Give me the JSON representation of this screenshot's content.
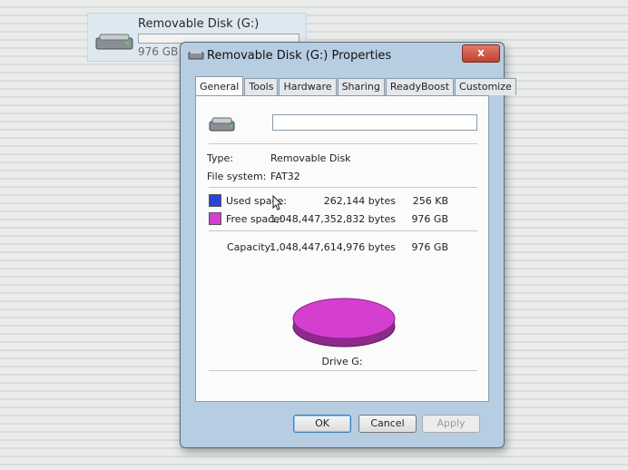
{
  "background_item": {
    "title": "Removable Disk (G:)",
    "subtitle": "976 GB f"
  },
  "dialog": {
    "title": "Removable Disk (G:) Properties",
    "close_label": "x",
    "tabs": [
      {
        "label": "General",
        "active": true
      },
      {
        "label": "Tools",
        "active": false
      },
      {
        "label": "Hardware",
        "active": false
      },
      {
        "label": "Sharing",
        "active": false
      },
      {
        "label": "ReadyBoost",
        "active": false
      },
      {
        "label": "Customize",
        "active": false
      }
    ],
    "name_field": {
      "value": ""
    },
    "type": {
      "label": "Type:",
      "value": "Removable Disk"
    },
    "file_system": {
      "label": "File system:",
      "value": "FAT32"
    },
    "used": {
      "label": "Used space:",
      "bytes": "262,144 bytes",
      "size": "256 KB",
      "color": "#2a46d8"
    },
    "free": {
      "label": "Free space:",
      "bytes": "1,048,447,352,832 bytes",
      "size": "976 GB",
      "color": "#d43fd0"
    },
    "capacity": {
      "label": "Capacity:",
      "bytes": "1,048,447,614,976 bytes",
      "size": "976 GB"
    },
    "drive_label": "Drive G:",
    "buttons": {
      "ok": "OK",
      "cancel": "Cancel",
      "apply": "Apply"
    }
  }
}
